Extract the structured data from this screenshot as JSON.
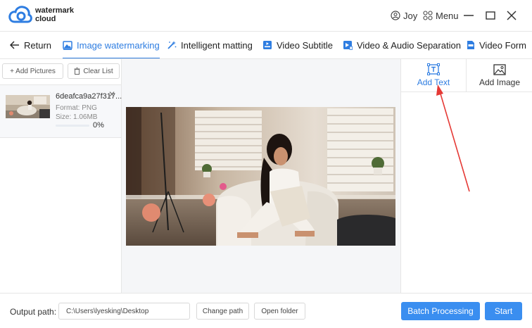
{
  "app": {
    "name_line1": "watermark",
    "name_line2": "cloud",
    "user_name": "Joy",
    "menu_label": "Menu"
  },
  "nav": {
    "return_label": "Return",
    "tabs": [
      {
        "label": "Image watermarking",
        "icon": "image-icon",
        "active": true
      },
      {
        "label": "Intelligent matting",
        "icon": "magic-wand-icon",
        "active": false
      },
      {
        "label": "Video Subtitle",
        "icon": "video-subtitle-icon",
        "active": false
      },
      {
        "label": "Video & Audio Separation",
        "icon": "video-audio-icon",
        "active": false
      },
      {
        "label": "Video Form",
        "icon": "video-format-icon",
        "active": false
      }
    ]
  },
  "left": {
    "add_pictures": "+ Add Pictures",
    "clear_list": "Clear List",
    "file": {
      "name": "6deafca9a27f317...",
      "format": "Format:  PNG",
      "size": "Size:  1.06MB",
      "progress_percent": "0%",
      "progress_value": 0
    }
  },
  "right": {
    "tabs": [
      {
        "label": "Add Text",
        "active": true
      },
      {
        "label": "Add Image",
        "active": false
      }
    ]
  },
  "bottom": {
    "output_label": "Output path:",
    "output_path": "C:\\Users\\lyesking\\Desktop",
    "change_path": "Change path",
    "open_folder": "Open folder",
    "batch_processing": "Batch Processing",
    "start": "Start"
  },
  "colors": {
    "accent": "#2e7de1",
    "primary_button": "#3a8ef0",
    "annotation_arrow": "#e53935"
  }
}
